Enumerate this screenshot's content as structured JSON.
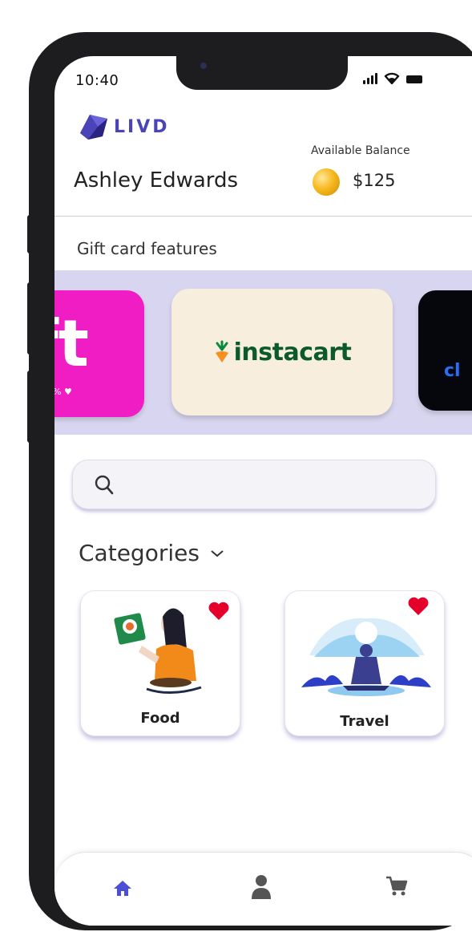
{
  "status_bar": {
    "time": "10:40"
  },
  "brand": {
    "name": "LIVD",
    "color": "#4a44b8"
  },
  "user": {
    "name": "Ashley Edwards",
    "balance_label": "Available Balance",
    "balance_value": "$125"
  },
  "gift_cards": {
    "title": "Gift card features",
    "cards": [
      {
        "brand_text": "ft",
        "background": "#f01cc4"
      },
      {
        "brand_text": "instacart",
        "background": "#f8eedd"
      },
      {
        "brand_text": "cl",
        "background": "#05070d"
      }
    ]
  },
  "search": {
    "placeholder": "",
    "value": ""
  },
  "categories": {
    "title": "Categories",
    "items": [
      {
        "label": "Food",
        "favorited": true
      },
      {
        "label": "Travel",
        "favorited": true
      }
    ]
  },
  "bottom_nav": {
    "items": [
      {
        "icon": "home-icon",
        "active": true
      },
      {
        "icon": "profile-icon",
        "active": false
      },
      {
        "icon": "cart-icon",
        "active": false
      }
    ],
    "active_color": "#4a4fd4",
    "inactive_color": "#555555"
  },
  "colors": {
    "carousel_bg": "#d8d5f0",
    "heart": "#e4002b",
    "accent_shadow": "#5a50aa"
  }
}
